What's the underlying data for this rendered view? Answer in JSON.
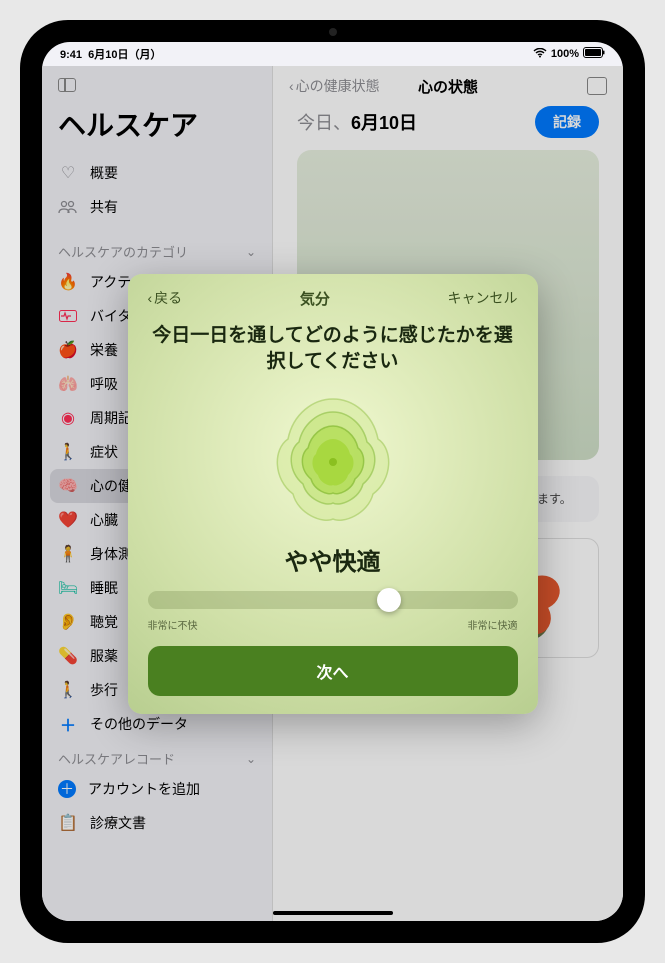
{
  "status": {
    "time": "9:41",
    "date": "6月10日（月）",
    "battery": "100%",
    "battery_icon": "􀛨"
  },
  "sidebar": {
    "app_title": "ヘルスケア",
    "overview": "概要",
    "share": "共有",
    "category_header": "ヘルスケアのカテゴリ",
    "records_header": "ヘルスケアレコード",
    "items": [
      {
        "icon": "🔥",
        "label": "アクティビティ",
        "color": "#ff3b30"
      },
      {
        "icon": "⎍",
        "label": "バイタル",
        "color": "#ff2d55"
      },
      {
        "icon": "🍎",
        "label": "栄養",
        "color": "#34c759"
      },
      {
        "icon": "🫁",
        "label": "呼吸",
        "color": "#5ac8fa"
      },
      {
        "icon": "⊙",
        "label": "周期記録",
        "color": "#ff2d55"
      },
      {
        "icon": "🚶",
        "label": "症状",
        "color": "#af52de"
      },
      {
        "icon": "🧠",
        "label": "心の健康状態",
        "color": "#5ac8fa",
        "selected": true
      },
      {
        "icon": "❤️",
        "label": "心臓",
        "color": "#ff3b30"
      },
      {
        "icon": "🧍",
        "label": "身体測定値",
        "color": "#af52de"
      },
      {
        "icon": "🛏",
        "label": "睡眠",
        "color": "#30d158"
      },
      {
        "icon": "👂",
        "label": "聴覚",
        "color": "#007aff"
      },
      {
        "icon": "💊",
        "label": "服薬",
        "color": "#5ac8fa"
      },
      {
        "icon": "🚶",
        "label": "歩行",
        "color": "#ff9500"
      },
      {
        "icon": "＋",
        "label": "その他のデータ",
        "color": "#007aff"
      }
    ],
    "records": [
      {
        "icon": "＋",
        "label": "アカウントを追加",
        "color": "#007aff"
      },
      {
        "icon": "📋",
        "label": "診療文書",
        "color": "#007aff"
      }
    ]
  },
  "main": {
    "back_label": "心の健康状態",
    "title": "心の状態",
    "date_prefix": "今日、",
    "date": "6月10日",
    "record_button": "記録",
    "info_text": "の気分\n分の記\nち、心\n央され\n加す\n役立ち\nます。"
  },
  "modal": {
    "back": "戻る",
    "title": "気分",
    "cancel": "キャンセル",
    "heading": "今日一日を通してどのように感じたかを選択してください",
    "mood_label": "やや快適",
    "slider_min": "非常に不快",
    "slider_max": "非常に快適",
    "next_button": "次へ"
  }
}
